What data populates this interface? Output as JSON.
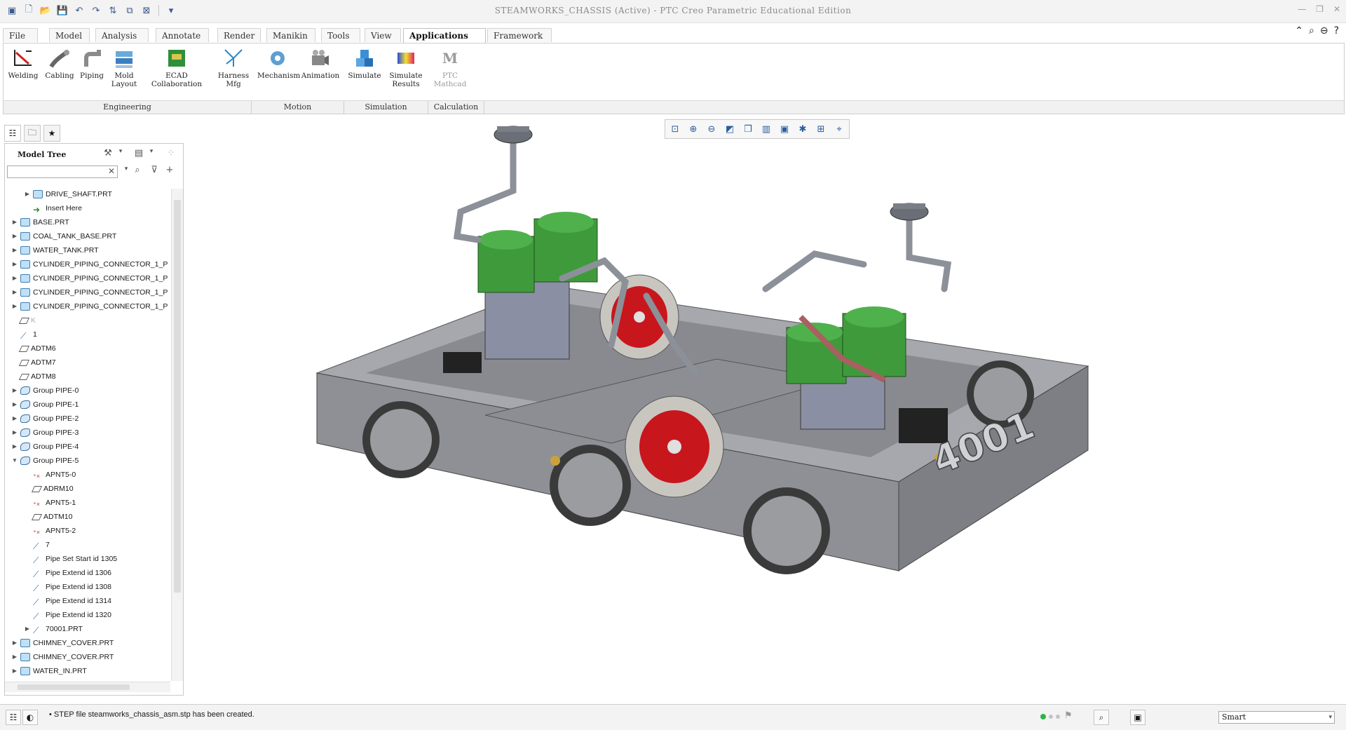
{
  "window": {
    "title": "STEAMWORKS_CHASSIS (Active) - PTC Creo Parametric Educational Edition"
  },
  "menu_tabs": [
    "File",
    "Model",
    "Analysis",
    "Annotate",
    "Render",
    "Manikin",
    "Tools",
    "View",
    "Applications",
    "Framework"
  ],
  "active_tab": "Applications",
  "ribbon": {
    "buttons": [
      {
        "label": "Welding",
        "icon": "welding-icon"
      },
      {
        "label": "Cabling",
        "icon": "cabling-icon"
      },
      {
        "label": "Piping",
        "icon": "piping-icon"
      },
      {
        "label": "Mold Layout",
        "icon": "mold-layout-icon"
      },
      {
        "label": "ECAD Collaboration",
        "icon": "ecad-icon"
      },
      {
        "label": "Harness Mfg",
        "icon": "harness-icon"
      },
      {
        "label": "Mechanism",
        "icon": "mechanism-icon"
      },
      {
        "label": "Animation",
        "icon": "animation-icon"
      },
      {
        "label": "Simulate",
        "icon": "simulate-icon"
      },
      {
        "label": "Simulate Results",
        "icon": "simulate-results-icon"
      },
      {
        "label": "PTC Mathcad",
        "icon": "mathcad-icon"
      }
    ],
    "groups": [
      "Engineering",
      "Motion",
      "Simulation",
      "Calculation"
    ]
  },
  "model_tree": {
    "title": "Model Tree",
    "search_value": "",
    "items": [
      {
        "label": "DRIVE_SHAFT.PRT",
        "type": "part",
        "level": 1,
        "expander": "▶"
      },
      {
        "label": "Insert Here",
        "type": "insert",
        "level": 1,
        "expander": ""
      },
      {
        "label": "BASE.PRT",
        "type": "part",
        "level": 0,
        "expander": "▶"
      },
      {
        "label": "COAL_TANK_BASE.PRT",
        "type": "part",
        "level": 0,
        "expander": "▶"
      },
      {
        "label": "WATER_TANK.PRT",
        "type": "part",
        "level": 0,
        "expander": "▶"
      },
      {
        "label": "CYLINDER_PIPING_CONNECTOR_1_P",
        "type": "part",
        "level": 0,
        "expander": "▶"
      },
      {
        "label": "CYLINDER_PIPING_CONNECTOR_1_P",
        "type": "part",
        "level": 0,
        "expander": "▶"
      },
      {
        "label": "CYLINDER_PIPING_CONNECTOR_1_P",
        "type": "part",
        "level": 0,
        "expander": "▶"
      },
      {
        "label": "CYLINDER_PIPING_CONNECTOR_1_P",
        "type": "part",
        "level": 0,
        "expander": "▶"
      },
      {
        "label": "K",
        "type": "dim",
        "level": 0,
        "expander": ""
      },
      {
        "label": "1",
        "type": "pipe",
        "level": 0,
        "expander": ""
      },
      {
        "label": "ADTM6",
        "type": "datum",
        "level": 0,
        "expander": ""
      },
      {
        "label": "ADTM7",
        "type": "datum",
        "level": 0,
        "expander": ""
      },
      {
        "label": "ADTM8",
        "type": "datum",
        "level": 0,
        "expander": ""
      },
      {
        "label": "Group PIPE-0",
        "type": "group",
        "level": 0,
        "expander": "▶"
      },
      {
        "label": "Group PIPE-1",
        "type": "group",
        "level": 0,
        "expander": "▶"
      },
      {
        "label": "Group PIPE-2",
        "type": "group",
        "level": 0,
        "expander": "▶"
      },
      {
        "label": "Group PIPE-3",
        "type": "group",
        "level": 0,
        "expander": "▶"
      },
      {
        "label": "Group PIPE-4",
        "type": "group",
        "level": 0,
        "expander": "▶"
      },
      {
        "label": "Group PIPE-5",
        "type": "group",
        "level": 0,
        "expander": "▼"
      },
      {
        "label": "APNT5-0",
        "type": "pnt",
        "level": 1,
        "expander": ""
      },
      {
        "label": "ADRM10",
        "type": "datum",
        "level": 1,
        "expander": ""
      },
      {
        "label": "APNT5-1",
        "type": "pnt",
        "level": 1,
        "expander": ""
      },
      {
        "label": "ADTM10",
        "type": "datum",
        "level": 1,
        "expander": ""
      },
      {
        "label": "APNT5-2",
        "type": "pnt",
        "level": 1,
        "expander": ""
      },
      {
        "label": "7",
        "type": "pipe",
        "level": 1,
        "expander": ""
      },
      {
        "label": "Pipe Set Start id 1305",
        "type": "pipe",
        "level": 1,
        "expander": ""
      },
      {
        "label": "Pipe Extend id 1306",
        "type": "pipe",
        "level": 1,
        "expander": ""
      },
      {
        "label": "Pipe Extend id 1308",
        "type": "pipe",
        "level": 1,
        "expander": ""
      },
      {
        "label": "Pipe Extend id 1314",
        "type": "pipe",
        "level": 1,
        "expander": ""
      },
      {
        "label": "Pipe Extend id 1320",
        "type": "pipe",
        "level": 1,
        "expander": ""
      },
      {
        "label": "70001.PRT",
        "type": "pipe",
        "level": 1,
        "expander": "▶"
      },
      {
        "label": "CHIMNEY_COVER.PRT",
        "type": "part",
        "level": 0,
        "expander": "▶"
      },
      {
        "label": "CHIMNEY_COVER.PRT",
        "type": "part",
        "level": 0,
        "expander": "▶"
      },
      {
        "label": "WATER_IN.PRT",
        "type": "part",
        "level": 0,
        "expander": "▶"
      }
    ]
  },
  "model_labels": {
    "chassis_number": "4001"
  },
  "status": {
    "message": "STEP file steamworks_chassis_asm.stp has been created.",
    "filter_value": "Smart"
  },
  "colors": {
    "accent": "#2a5d9e",
    "cylinder_green": "#3f9a3c",
    "wheel_red": "#c8161d",
    "chassis_gray": "#8e9096"
  }
}
